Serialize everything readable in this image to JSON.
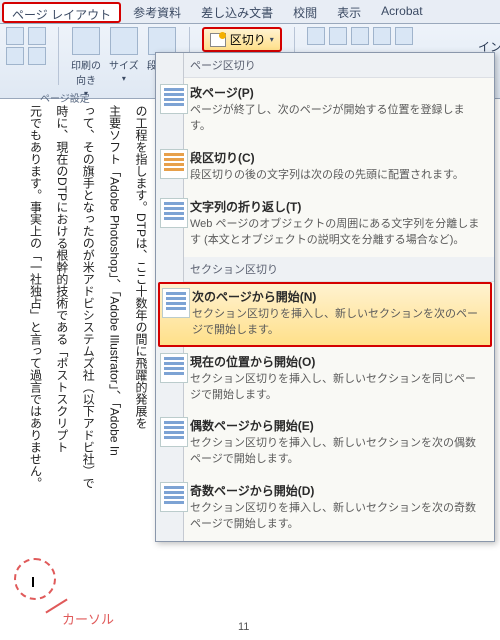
{
  "tabs": [
    "ページ レイアウト",
    "参考資料",
    "差し込み文書",
    "校閲",
    "表示",
    "Acrobat"
  ],
  "active_tab": 0,
  "ribbon": {
    "print_dir": "印刷の\n向き",
    "size": "サイズ",
    "columns": "段組み",
    "group_title": "ページ設定",
    "breaks_label": "区切り",
    "insert_label": "イン"
  },
  "menu": {
    "section1_title": "ページ区切り",
    "items1": [
      {
        "title": "改ページ(P)",
        "desc": "ページが終了し、次のページが開始する位置を登録します。",
        "variant": "blue"
      },
      {
        "title": "段区切り(C)",
        "desc": "段区切りの後の文字列は次の段の先頭に配置されます。",
        "variant": "orange"
      },
      {
        "title": "文字列の折り返し(T)",
        "desc": "Web ページのオブジェクトの周囲にある文字列を分離します (本文とオブジェクトの説明文を分離する場合など)。",
        "variant": "blue"
      }
    ],
    "section2_title": "セクション区切り",
    "items2": [
      {
        "title": "次のページから開始(N)",
        "desc": "セクション区切りを挿入し、新しいセクションを次のページで開始します。",
        "variant": "blue",
        "highlight": true
      },
      {
        "title": "現在の位置から開始(O)",
        "desc": "セクション区切りを挿入し、新しいセクションを同じページで開始します。",
        "variant": "blue"
      },
      {
        "title": "偶数ページから開始(E)",
        "desc": "セクション区切りを挿入し、新しいセクションを次の偶数ページで開始します。",
        "variant": "blue"
      },
      {
        "title": "奇数ページから開始(D)",
        "desc": "セクション区切りを挿入し、新しいセクションを次の奇数ページで開始します。",
        "variant": "blue"
      }
    ]
  },
  "doc_text": "の工程を指します。DTPは、ここ十数年の間に飛躍的発展を\n主要ソフト「Adobe Photoshop」、「Adobe Illustrator」、「Adobe In\nって、その旗手となったのが米アドビシステムズ社（以下アドビ社）で\n時に、現在のDTPにおける根幹的技術である「ポストスクリプト\n元でもあります。事実上の「一社独占」と言って過言ではありません。",
  "page_number": "11",
  "cursor_label": "カーソル"
}
